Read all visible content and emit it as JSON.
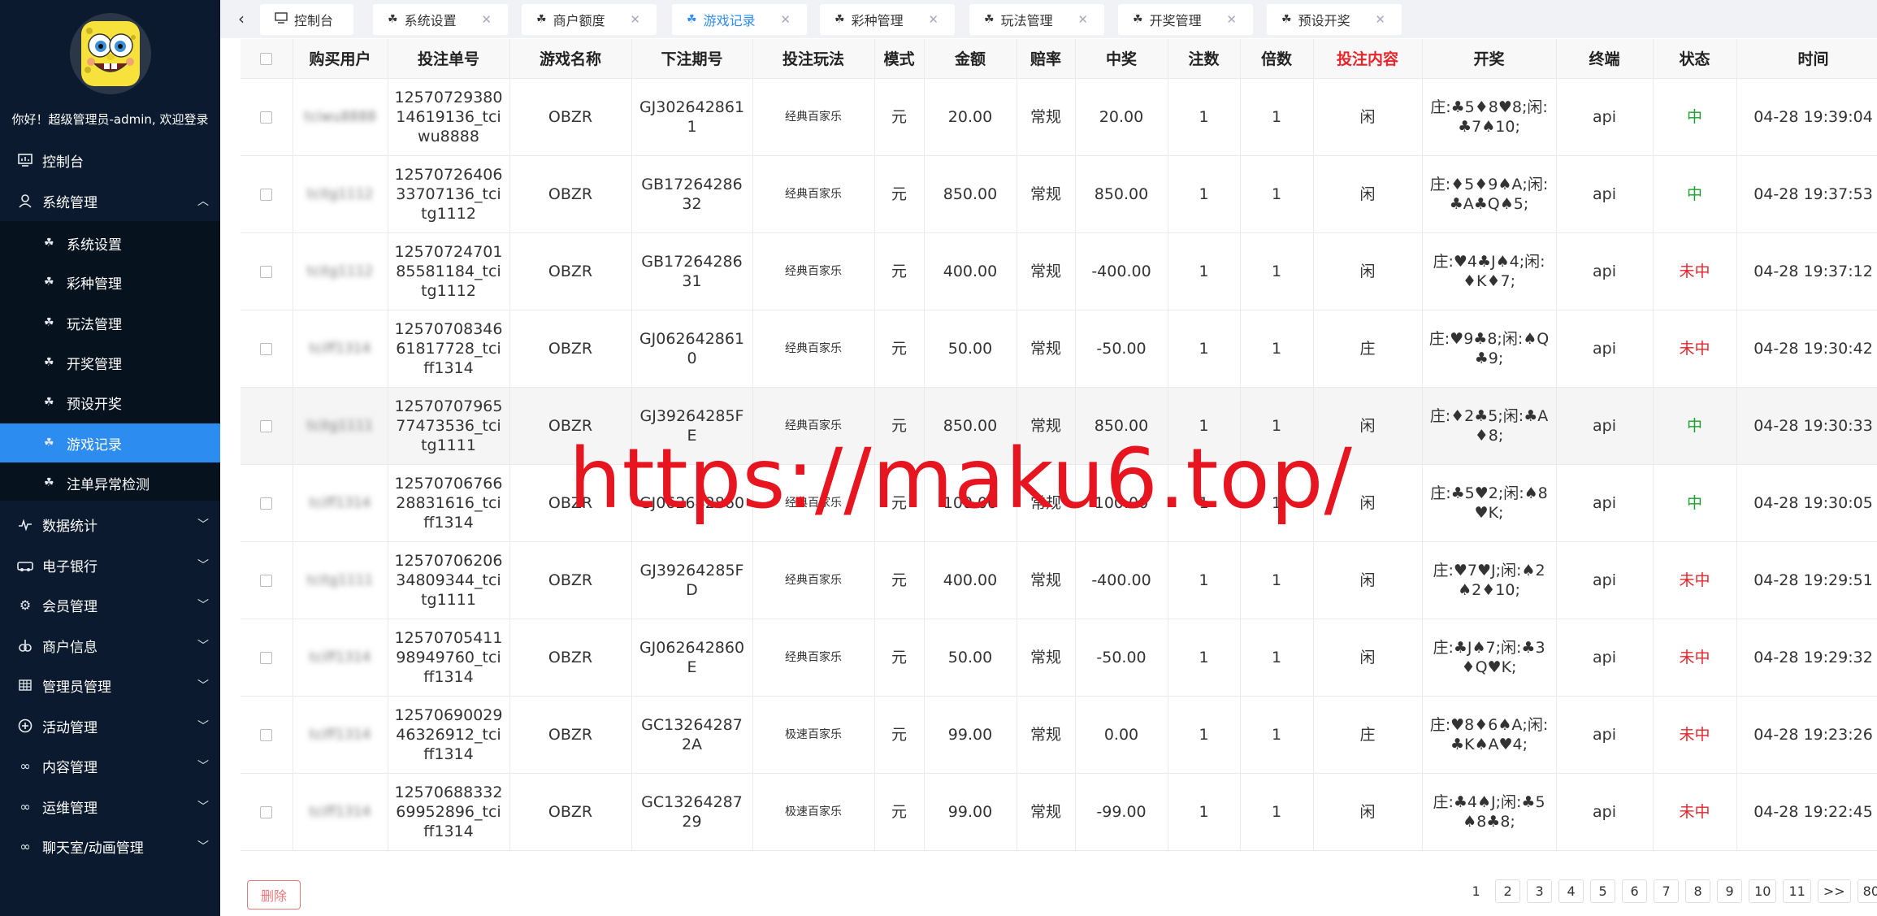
{
  "sidebar": {
    "welcome": "你好！超级管理员-admin, 欢迎登录",
    "nav": [
      {
        "label": "控制台",
        "icon": "dashboard-icon"
      },
      {
        "label": "系统管理",
        "icon": "user-icon",
        "expanded": true
      },
      {
        "label": "数据统计",
        "icon": "chart-icon"
      },
      {
        "label": "电子银行",
        "icon": "bank-icon"
      },
      {
        "label": "会员管理",
        "icon": "gear-icon"
      },
      {
        "label": "商户信息",
        "icon": "merchant-icon"
      },
      {
        "label": "管理员管理",
        "icon": "grid-icon"
      },
      {
        "label": "活动管理",
        "icon": "plus-circle-icon"
      },
      {
        "label": "内容管理",
        "icon": "link-icon"
      },
      {
        "label": "运维管理",
        "icon": "link-icon"
      },
      {
        "label": "聊天室/动画管理",
        "icon": "link-icon"
      }
    ],
    "sub": [
      {
        "label": "系统设置"
      },
      {
        "label": "彩种管理"
      },
      {
        "label": "玩法管理"
      },
      {
        "label": "开奖管理"
      },
      {
        "label": "预设开奖"
      },
      {
        "label": "游戏记录",
        "active": true
      },
      {
        "label": "注单异常检测"
      }
    ]
  },
  "tabs": [
    {
      "label": "控制台",
      "closable": false
    },
    {
      "label": "系统设置",
      "closable": true
    },
    {
      "label": "商户额度",
      "closable": true
    },
    {
      "label": "游戏记录",
      "closable": true,
      "active": true
    },
    {
      "label": "彩种管理",
      "closable": true
    },
    {
      "label": "玩法管理",
      "closable": true
    },
    {
      "label": "开奖管理",
      "closable": true
    },
    {
      "label": "预设开奖",
      "closable": true
    }
  ],
  "table": {
    "columns": [
      "购买用户",
      "投注单号",
      "游戏名称",
      "下注期号",
      "投注玩法",
      "模式",
      "金额",
      "赔率",
      "中奖",
      "注数",
      "倍数",
      "投注内容",
      "开奖",
      "终端",
      "状态",
      "时间"
    ],
    "rows": [
      {
        "user": "tciwu8888",
        "order": "1257072938014619136_tciwu8888",
        "game": "OBZR",
        "issue": "GJ3026428611",
        "play": "经典百家乐",
        "mode": "元",
        "amount": "20.00",
        "odds": "常规",
        "win": "20.00",
        "count": "1",
        "multiple": "1",
        "content": "闲",
        "draw": "庄:♣5♦8♥8;闲:♣7♠10;",
        "terminal": "api",
        "status": "中",
        "time": "04-28 19:39:04"
      },
      {
        "user": "tcitg1112",
        "order": "1257072640633707136_tcitg1112",
        "game": "OBZR",
        "issue": "GB1726428632",
        "play": "经典百家乐",
        "mode": "元",
        "amount": "850.00",
        "odds": "常规",
        "win": "850.00",
        "count": "1",
        "multiple": "1",
        "content": "闲",
        "draw": "庄:♦5♦9♠A;闲:♣A♣Q♠5;",
        "terminal": "api",
        "status": "中",
        "time": "04-28 19:37:53"
      },
      {
        "user": "tcitg1112",
        "order": "1257072470185581184_tcitg1112",
        "game": "OBZR",
        "issue": "GB1726428631",
        "play": "经典百家乐",
        "mode": "元",
        "amount": "400.00",
        "odds": "常规",
        "win": "-400.00",
        "count": "1",
        "multiple": "1",
        "content": "闲",
        "draw": "庄:♥4♣J♠4;闲:♦K♦7;",
        "terminal": "api",
        "status": "未中",
        "time": "04-28 19:37:12"
      },
      {
        "user": "tciff1314",
        "order": "1257070834661817728_tciff1314",
        "game": "OBZR",
        "issue": "GJ0626428610",
        "play": "经典百家乐",
        "mode": "元",
        "amount": "50.00",
        "odds": "常规",
        "win": "-50.00",
        "count": "1",
        "multiple": "1",
        "content": "庄",
        "draw": "庄:♥9♣8;闲:♠Q♣9;",
        "terminal": "api",
        "status": "未中",
        "time": "04-28 19:30:42"
      },
      {
        "user": "tcitg1111",
        "order": "1257070796577473536_tcitg1111",
        "game": "OBZR",
        "issue": "GJ39264285FE",
        "play": "经典百家乐",
        "mode": "元",
        "amount": "850.00",
        "odds": "常规",
        "win": "850.00",
        "count": "1",
        "multiple": "1",
        "content": "闲",
        "draw": "庄:♦2♣5;闲:♣A♦8;",
        "terminal": "api",
        "status": "中",
        "time": "04-28 19:30:33"
      },
      {
        "user": "tciff1314",
        "order": "1257070676628831616_tciff1314",
        "game": "OBZR",
        "issue": "GJ062642860",
        "play": "经典百家乐",
        "mode": "元",
        "amount": "100.00",
        "odds": "常规",
        "win": "100.00",
        "count": "1",
        "multiple": "1",
        "content": "闲",
        "draw": "庄:♣5♥2;闲:♠8♥K;",
        "terminal": "api",
        "status": "中",
        "time": "04-28 19:30:05"
      },
      {
        "user": "tcitg1111",
        "order": "1257070620634809344_tcitg1111",
        "game": "OBZR",
        "issue": "GJ39264285FD",
        "play": "经典百家乐",
        "mode": "元",
        "amount": "400.00",
        "odds": "常规",
        "win": "-400.00",
        "count": "1",
        "multiple": "1",
        "content": "闲",
        "draw": "庄:♥7♥J;闲:♠2♠2♦10;",
        "terminal": "api",
        "status": "未中",
        "time": "04-28 19:29:51"
      },
      {
        "user": "tciff1314",
        "order": "1257070541198949760_tciff1314",
        "game": "OBZR",
        "issue": "GJ062642860E",
        "play": "经典百家乐",
        "mode": "元",
        "amount": "50.00",
        "odds": "常规",
        "win": "-50.00",
        "count": "1",
        "multiple": "1",
        "content": "闲",
        "draw": "庄:♣J♠7;闲:♣3♦Q♥K;",
        "terminal": "api",
        "status": "未中",
        "time": "04-28 19:29:32"
      },
      {
        "user": "tciff1314",
        "order": "1257069002946326912_tciff1314",
        "game": "OBZR",
        "issue": "GC132642872A",
        "play": "极速百家乐",
        "mode": "元",
        "amount": "99.00",
        "odds": "常规",
        "win": "0.00",
        "count": "1",
        "multiple": "1",
        "content": "庄",
        "draw": "庄:♥8♦6♠A;闲:♣K♠A♥4;",
        "terminal": "api",
        "status": "未中",
        "time": "04-28 19:23:26"
      },
      {
        "user": "tciff1314",
        "order": "1257068833269952896_tciff1314",
        "game": "OBZR",
        "issue": "GC1326428729",
        "play": "极速百家乐",
        "mode": "元",
        "amount": "99.00",
        "odds": "常规",
        "win": "-99.00",
        "count": "1",
        "multiple": "1",
        "content": "闲",
        "draw": "庄:♣4♠J;闲:♣5♠8♣8;",
        "terminal": "api",
        "status": "未中",
        "time": "04-28 19:22:45"
      }
    ]
  },
  "footer": {
    "delete_label": "删除",
    "pages": [
      "1",
      "2",
      "3",
      "4",
      "5",
      "6",
      "7",
      "8",
      "9",
      "10",
      "11",
      ">>",
      "80"
    ],
    "current_page": "1"
  },
  "watermark": "https://maku6.top/",
  "colors": {
    "sidebar_bg": "#0b1a2e",
    "accent": "#2d8cf0",
    "win": "#19a030",
    "lose": "#e6252b",
    "watermark": "#e6151f"
  }
}
